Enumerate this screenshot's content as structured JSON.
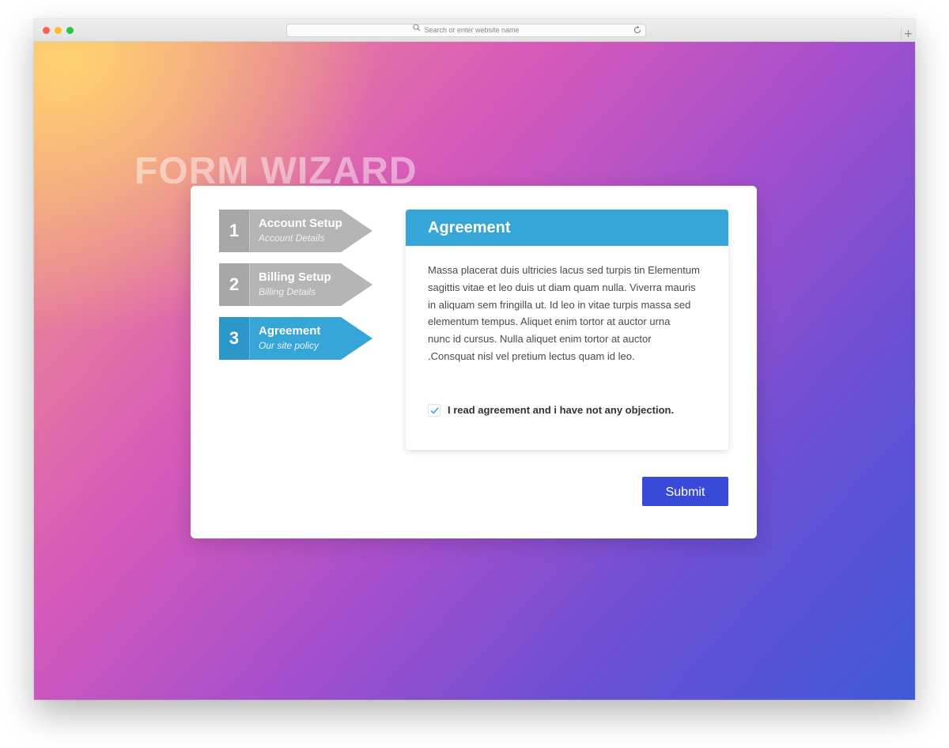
{
  "browser": {
    "address_placeholder": "Search or enter website name",
    "new_tab_label": "+"
  },
  "hero": {
    "title": "FORM WIZARD"
  },
  "wizard": {
    "steps": [
      {
        "number": "1",
        "title": "Account Setup",
        "subtitle": "Account Details",
        "state": "inactive"
      },
      {
        "number": "2",
        "title": "Billing Setup",
        "subtitle": "Billing Details",
        "state": "inactive"
      },
      {
        "number": "3",
        "title": "Agreement",
        "subtitle": "Our site policy",
        "state": "active"
      }
    ],
    "panel": {
      "title": "Agreement",
      "body": [
        "Massa placerat duis ultricies lacus sed turpis tin Elementum",
        "sagittis vitae et leo duis ut diam quam nulla. Viverra mauris",
        "in aliquam sem fringilla ut. Id leo in vitae turpis massa sed",
        "elementum tempus. Aliquet enim tortor at auctor urna",
        "nunc id cursus. Nulla aliquet enim tortor at auctor",
        ".Consquat nisl vel pretium lectus quam id leo."
      ],
      "checkbox_label": "I read agreement and i have not any objection.",
      "checkbox_checked": true
    },
    "submit_label": "Submit"
  },
  "colors": {
    "step_inactive": "#b5b5b5",
    "step_inactive_num": "#a7a7a7",
    "step_active": "#36a5d8",
    "step_active_num": "#2e97ca",
    "panel_header": "#36a5d8",
    "submit": "#3a4ad8",
    "check": "#36a5d8"
  }
}
